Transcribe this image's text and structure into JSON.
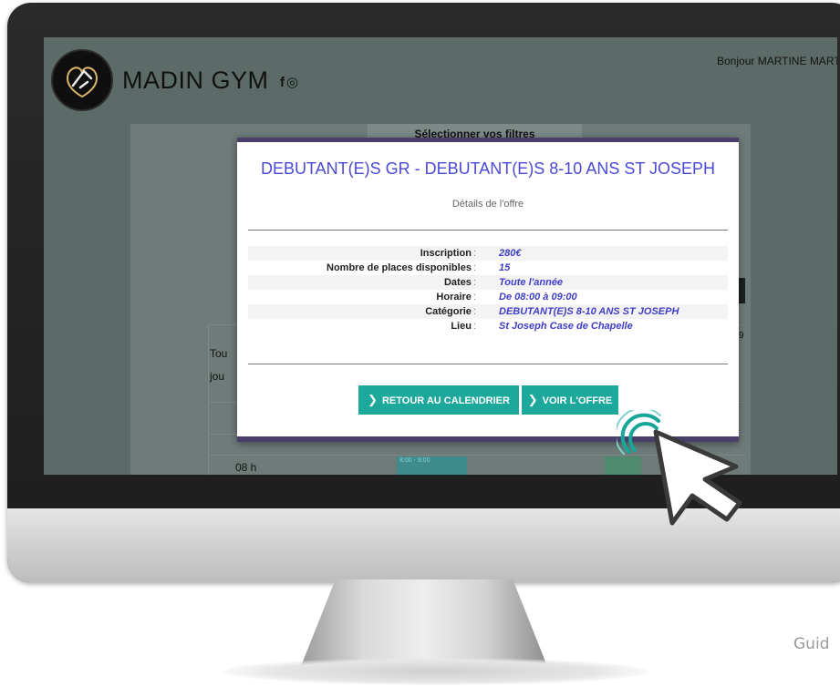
{
  "site": {
    "brand": "MADIN GYM",
    "social_icons": "f◎",
    "greeting": "Bonjour MARTINE MARTINE"
  },
  "background": {
    "filters_title": "Sélectionner vos filtres",
    "row_label_1": "Tou",
    "row_label_2": "jou",
    "hour_label": "08 h",
    "header_digit": "9",
    "event_text": "8:00 - 9:00"
  },
  "modal": {
    "title": "DEBUTANT(E)S GR - DEBUTANT(E)S 8-10 ANS ST JOSEPH",
    "subtitle": "Détails de l'offre",
    "details": [
      {
        "label": "Inscription",
        "value": "280€"
      },
      {
        "label": "Nombre de places disponibles",
        "value": "15"
      },
      {
        "label": "Dates",
        "value": "Toute l'année"
      },
      {
        "label": "Horaire",
        "value": "De 08:00 à 09:00"
      },
      {
        "label": "Catégorie",
        "value": "DEBUTANT(E)S 8-10 ANS ST JOSEPH"
      },
      {
        "label": "Lieu",
        "value": "St Joseph Case de Chapelle"
      }
    ],
    "buttons": {
      "retour": "RETOUR AU CALENDRIER",
      "voir": "VOIR L'OFFRE"
    }
  },
  "footer_text": "Guid",
  "colors": {
    "header_bg": "#5d6b68",
    "modal_accent": "#4a3f6b",
    "title_blue": "#4a4ad8",
    "button_teal": "#1da89c"
  },
  "icons": [
    "logo-icon",
    "facebook-icon",
    "instagram-icon",
    "chevron-right-icon",
    "click-ripple-icon",
    "cursor-arrow-icon"
  ]
}
